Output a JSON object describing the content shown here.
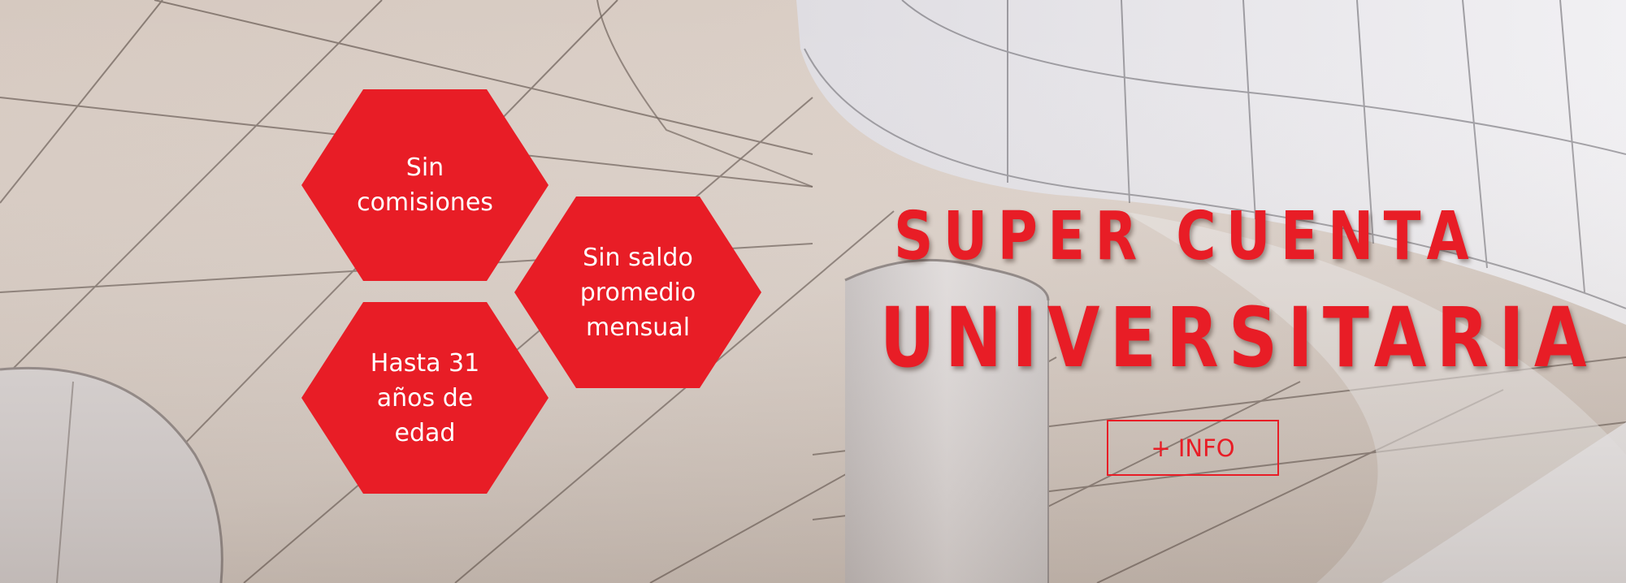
{
  "banner": {
    "colors": {
      "accent": "#e81d26",
      "hex_text": "#ffffff",
      "background_warm": "#d9cdc4",
      "background_light": "#ecebee"
    },
    "features": [
      {
        "label": "Sin\ncomisiones"
      },
      {
        "label": "Sin saldo\npromedio\nmensual"
      },
      {
        "label": "Hasta 31\naños de\nedad"
      }
    ],
    "headline": {
      "line1": "SUPER CUENTA",
      "line2": "UNIVERSITARIA"
    },
    "cta": {
      "label": "+ INFO"
    }
  }
}
